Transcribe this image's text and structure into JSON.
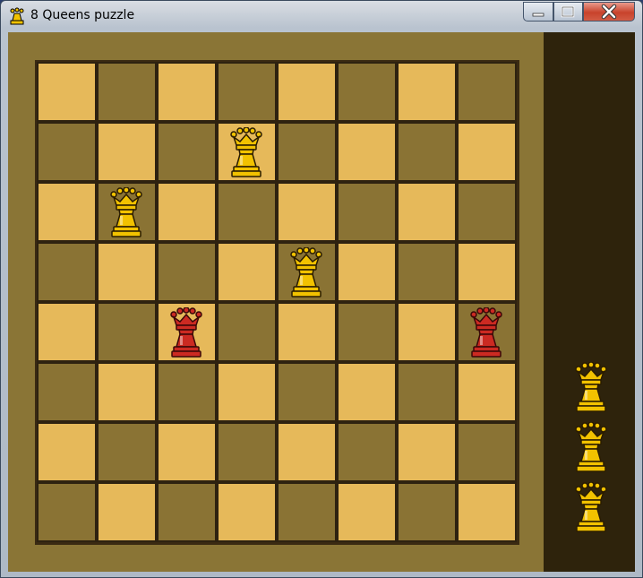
{
  "window": {
    "title": "8 Queens puzzle",
    "buttons": [
      "minimize",
      "maximize",
      "close"
    ]
  },
  "colors": {
    "light_square": "#e6b95a",
    "dark_square": "#8a7334",
    "board_background": "#8a7536",
    "sidebar": "#2e230c",
    "queen_gold": "#f2c200",
    "queen_red": "#cc2a22"
  },
  "board": {
    "size": 8,
    "queens": [
      {
        "row": 1,
        "col": 3,
        "state": "safe"
      },
      {
        "row": 2,
        "col": 1,
        "state": "safe"
      },
      {
        "row": 3,
        "col": 4,
        "state": "safe"
      },
      {
        "row": 4,
        "col": 2,
        "state": "attacked"
      },
      {
        "row": 4,
        "col": 7,
        "state": "attacked"
      }
    ]
  },
  "sidebar": {
    "remaining_queens": 3
  }
}
